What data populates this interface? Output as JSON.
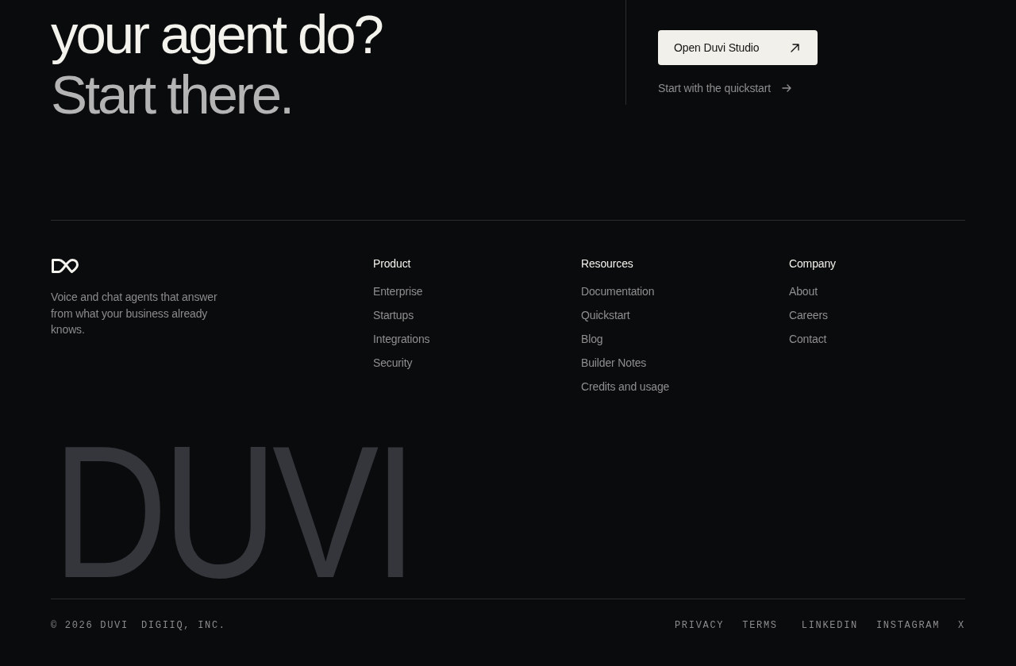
{
  "hero": {
    "headline": [
      {
        "text": "your agent do?",
        "muted": false
      },
      {
        "text": "Start there.",
        "muted": true
      }
    ],
    "primary_button": {
      "label": "Open Duvi Studio"
    },
    "secondary_link": {
      "label": "Start with the quickstart"
    }
  },
  "footer": {
    "tagline": "Voice and chat agents that answer from what your business already knows.",
    "columns": [
      {
        "heading": "Product",
        "links": [
          "Enterprise",
          "Startups",
          "Integrations",
          "Security"
        ]
      },
      {
        "heading": "Resources",
        "links": [
          "Documentation",
          "Quickstart",
          "Blog",
          "Builder Notes",
          "Credits and usage"
        ]
      },
      {
        "heading": "Company",
        "links": [
          "About",
          "Careers",
          "Contact"
        ]
      }
    ],
    "wordmark": "DUVI"
  },
  "bottom_bar": {
    "copyright": "© 2026 DUVI",
    "company": "DIGIIQ, INC.",
    "legal_links": [
      "PRIVACY",
      "TERMS"
    ],
    "social_links": [
      "LINKEDIN",
      "INSTAGRAM",
      "X"
    ]
  }
}
